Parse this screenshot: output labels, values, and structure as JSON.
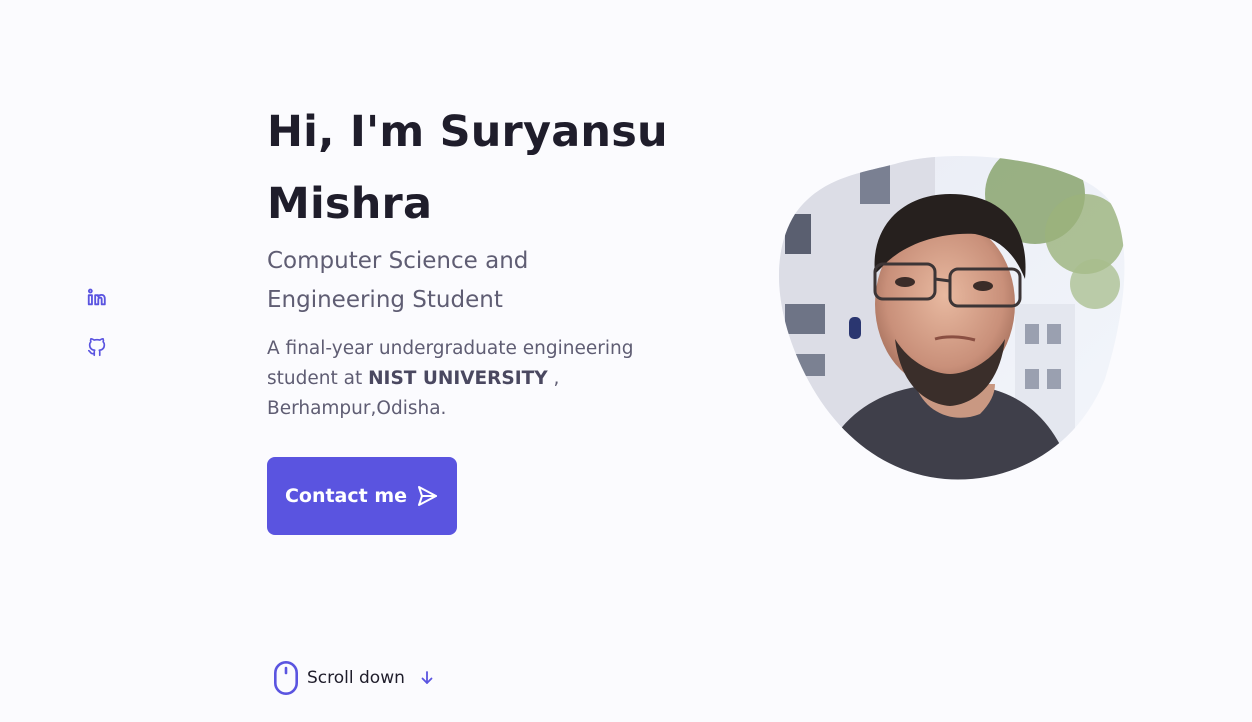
{
  "hero": {
    "title_line1": "Hi, I'm Suryansu",
    "title_line2": "Mishra",
    "subtitle": "Computer Science and Engineering Student",
    "desc_prefix": "A final-year undergraduate engineering student at ",
    "university": "NIST UNIVERSITY",
    "desc_suffix": " , Berhampur,Odisha.",
    "contact_label": "Contact me"
  },
  "scroll": {
    "label": "Scroll down"
  },
  "social": [
    {
      "icon": "linkedin-icon"
    },
    {
      "icon": "github-icon"
    }
  ],
  "colors": {
    "accent": "#5a54e0",
    "background": "#fbfbfe",
    "title": "#1f1d2b",
    "text": "#5f5d73"
  }
}
